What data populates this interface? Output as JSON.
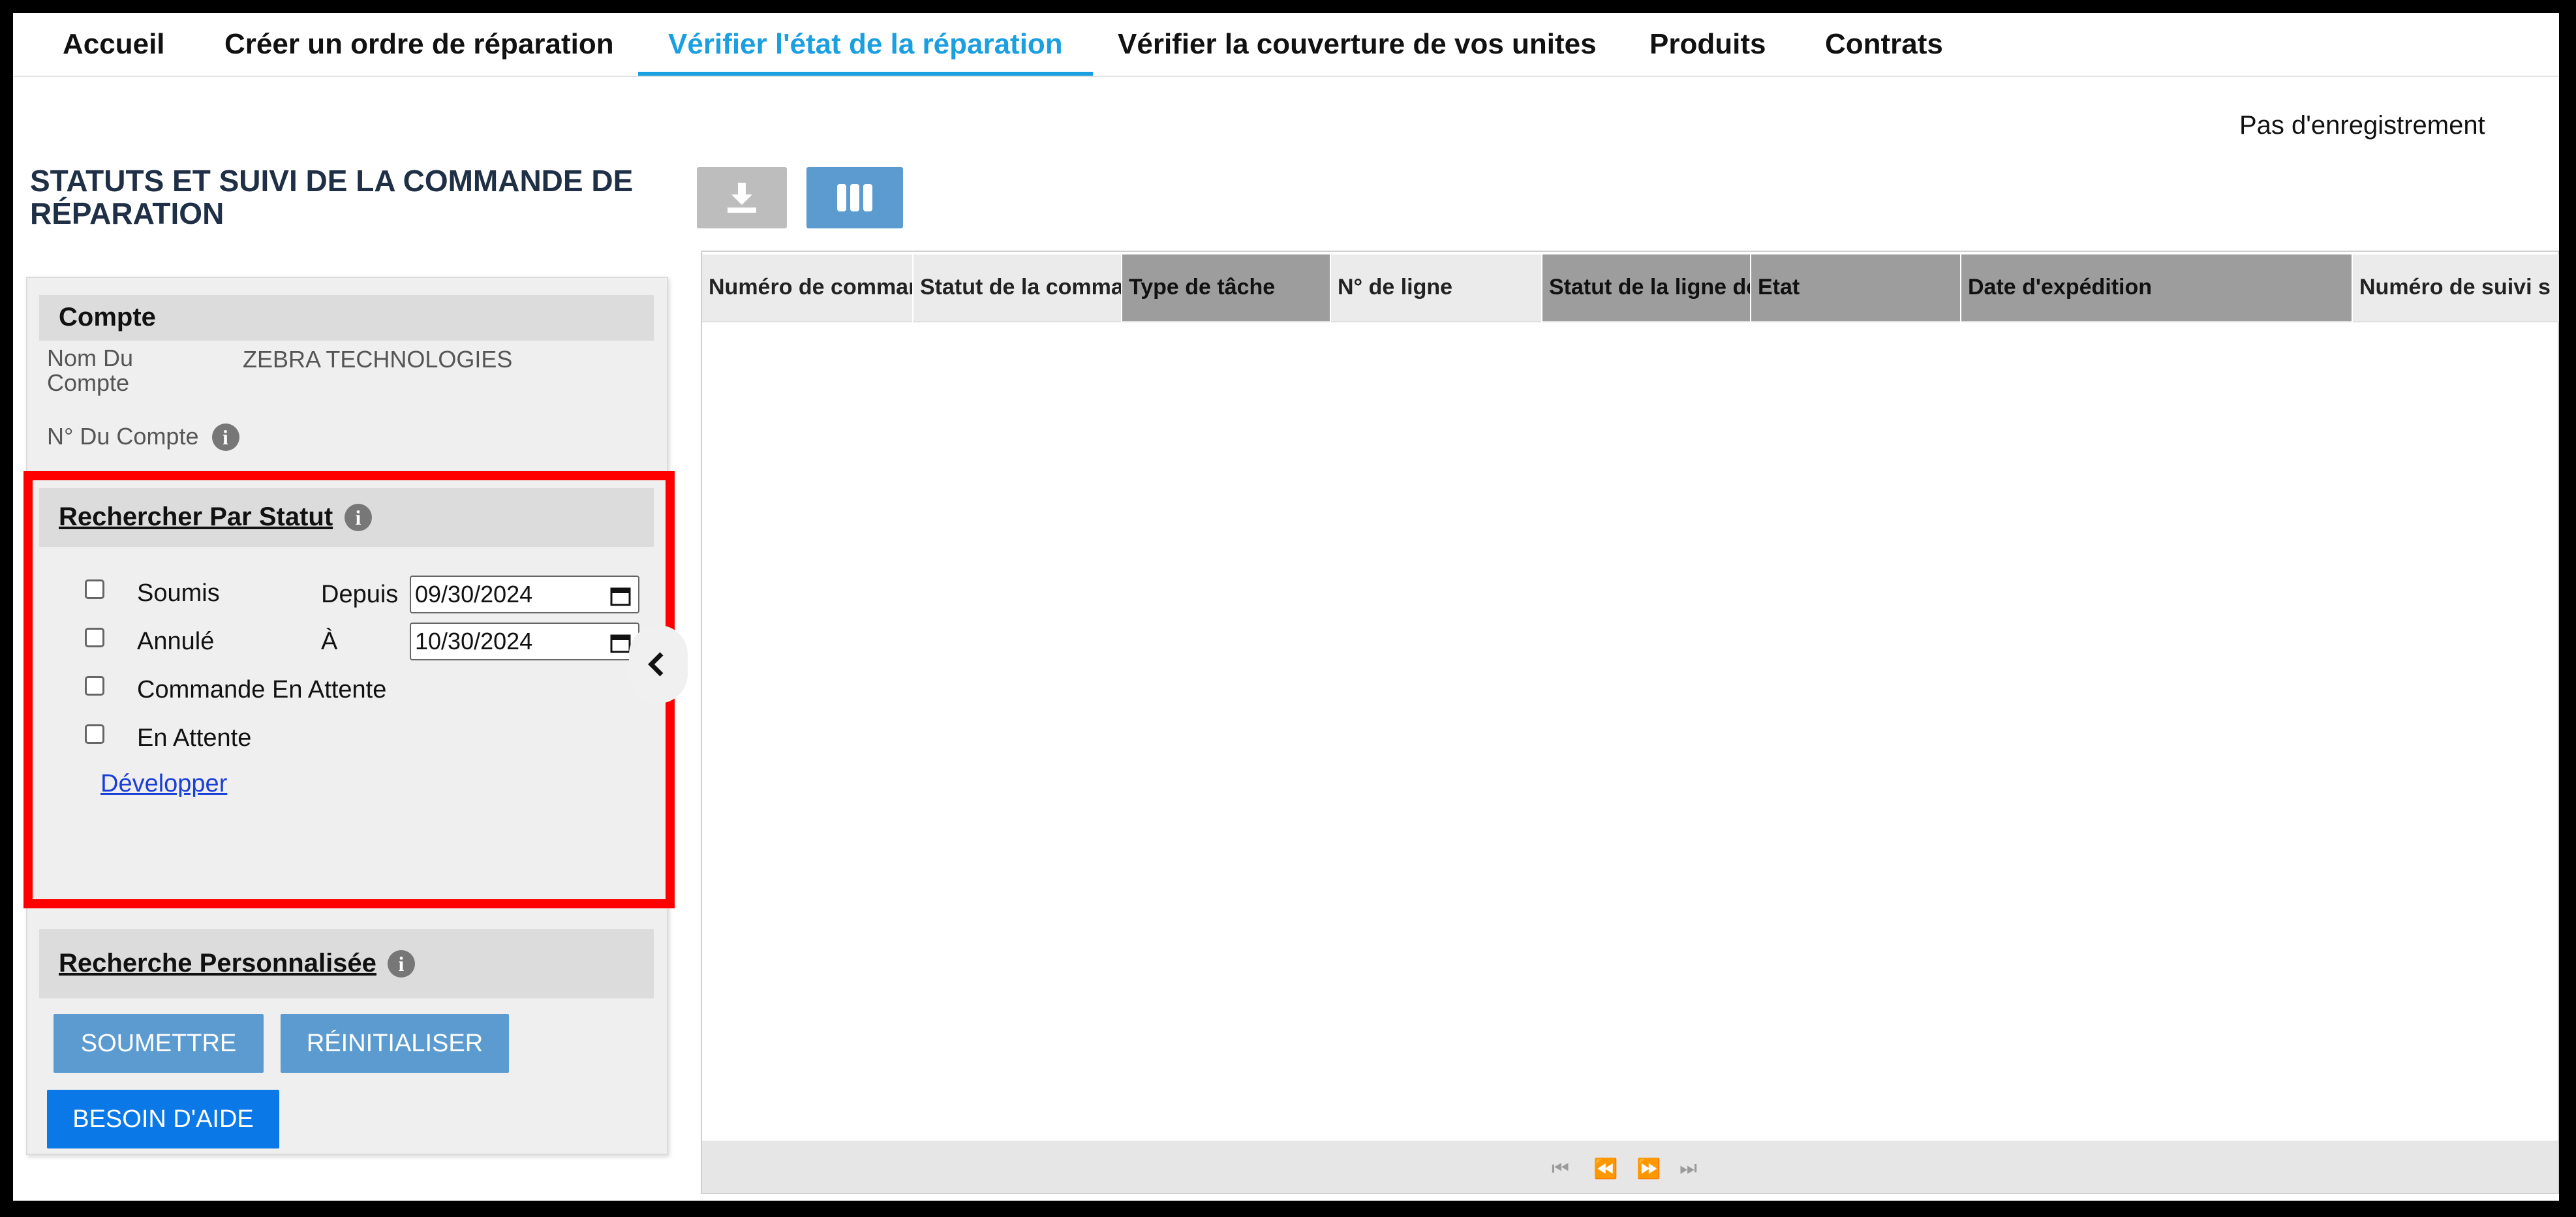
{
  "nav": {
    "items": [
      {
        "label": "Accueil",
        "active": false
      },
      {
        "label": "Créer un ordre de réparation",
        "active": false
      },
      {
        "label": "Vérifier l'état de la réparation",
        "active": true
      },
      {
        "label": "Vérifier la couverture de vos unites",
        "active": false
      },
      {
        "label": "Produits",
        "active": false
      },
      {
        "label": "Contrats",
        "active": false
      }
    ]
  },
  "status_text": "Pas d'enregistrement",
  "page_title": "STATUTS ET SUIVI DE LA COMMANDE DE RÉPARATION",
  "toolbar": {
    "download_icon": "download-icon",
    "columns_icon": "columns-icon"
  },
  "account": {
    "heading": "Compte",
    "name_label": "Nom Du Compte",
    "name_value": "ZEBRA TECHNOLOGIES",
    "number_label": "N° Du Compte",
    "number_value": ""
  },
  "search_by_status": {
    "heading": "Rechercher Par Statut",
    "statuses": [
      {
        "label": "Soumis",
        "checked": false
      },
      {
        "label": "Annulé",
        "checked": false
      },
      {
        "label": "Commande En Attente",
        "checked": false
      },
      {
        "label": "En Attente",
        "checked": false
      }
    ],
    "from_label": "Depuis",
    "from_value": "09/30/2024",
    "to_label": "À",
    "to_value": "10/30/2024",
    "expand_link": "Développer"
  },
  "custom_search": {
    "heading": "Recherche Personnalisée"
  },
  "buttons": {
    "submit": "SOUMETTRE",
    "reset": "RÉINITIALISER",
    "help": "BESOIN D'AIDE"
  },
  "grid": {
    "columns": [
      {
        "label": "Numéro de commande"
      },
      {
        "label": "Statut de la commande"
      },
      {
        "label": "Type de tâche"
      },
      {
        "label": "N° de ligne"
      },
      {
        "label": "Statut de la ligne de commande"
      },
      {
        "label": "Etat"
      },
      {
        "label": "Date d'expédition"
      },
      {
        "label": "Numéro de suivi s"
      }
    ],
    "rows": [],
    "pager_icons": [
      "first-page-icon",
      "prev-page-icon",
      "next-page-icon",
      "last-page-icon"
    ]
  },
  "colors": {
    "accent": "#1a9fe0",
    "highlight": "#ff0000",
    "button_blue": "#5b9bd0",
    "button_help": "#0b78e8"
  }
}
